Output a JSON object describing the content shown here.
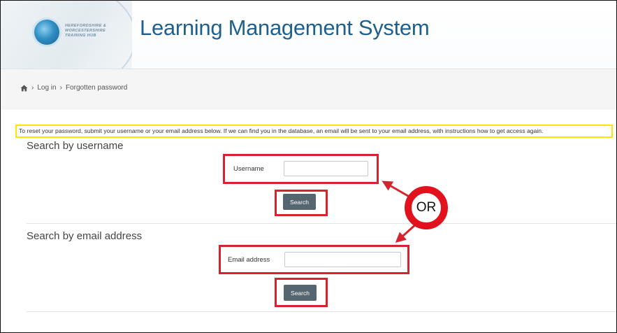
{
  "header": {
    "logo_lines": [
      "HEREFORDSHIRE &",
      "WORCESTERSHIRE",
      "TRAINING HUB"
    ],
    "title": "Learning Management System"
  },
  "breadcrumb": {
    "home_icon": "home-icon",
    "items": [
      "Log in",
      "Forgotten password"
    ],
    "separator": "›"
  },
  "instructions": "To reset your password, submit your username or your email address below. If we can find you in the database, an email will be sent to your email address, with instructions how to get access again.",
  "username_section": {
    "title": "Search by username",
    "field_label": "Username",
    "field_value": "",
    "button_label": "Search"
  },
  "email_section": {
    "title": "Search by email address",
    "field_label": "Email address",
    "field_value": "",
    "button_label": "Search"
  },
  "annotation": {
    "or_label": "OR"
  },
  "colors": {
    "title_blue": "#1f5f8e",
    "highlight_red": "#d6232e",
    "instruction_yellow": "#ffe600",
    "button_gray": "#566670"
  }
}
